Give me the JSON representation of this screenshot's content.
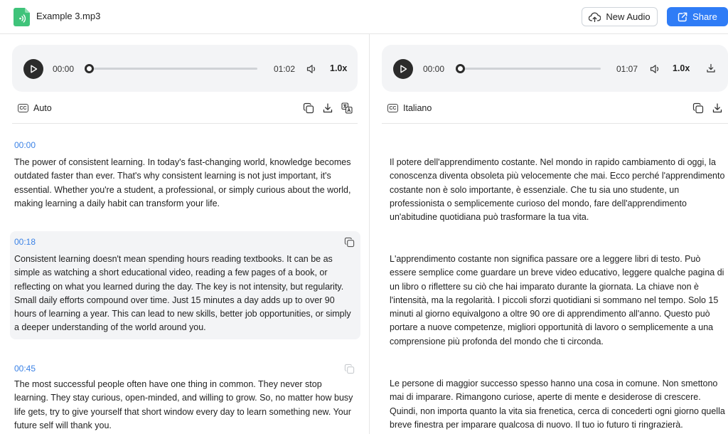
{
  "header": {
    "file_name": "Example 3.mp3",
    "new_audio_label": "New Audio",
    "share_label": "Share",
    "colors": {
      "accent": "#2f7cf6",
      "file_icon": "#3fc37a"
    }
  },
  "left": {
    "player": {
      "current_time": "00:00",
      "duration": "01:02",
      "speed": "1.0x",
      "progress": 0
    },
    "language": "Auto",
    "segments": [
      {
        "timestamp": "00:00",
        "text": "The power of consistent learning. In today's fast-changing world, knowledge becomes outdated faster than ever. That's why consistent learning is not just important, it's essential. Whether you're a student, a professional, or simply curious about the world, making learning a daily habit can transform your life."
      },
      {
        "timestamp": "00:18",
        "text": "Consistent learning doesn't mean spending hours reading textbooks. It can be as simple as watching a short educational video, reading a few pages of a book, or reflecting on what you learned during the day. The key is not intensity, but regularity. Small daily efforts compound over time. Just 15 minutes a day adds up to over 90 hours of learning a year. This can lead to new skills, better job opportunities, or simply a deeper understanding of the world around you."
      },
      {
        "timestamp": "00:45",
        "text": "The most successful people often have one thing in common. They never stop learning. They stay curious, open-minded, and willing to grow. So, no matter how busy life gets, try to give yourself that short window every day to learn something new. Your future self will thank you."
      }
    ]
  },
  "right": {
    "player": {
      "current_time": "00:00",
      "duration": "01:07",
      "speed": "1.0x",
      "progress": 0
    },
    "language": "Italiano",
    "segments": [
      {
        "text": "Il potere dell'apprendimento costante. Nel mondo in rapido cambiamento di oggi, la conoscenza diventa obsoleta più velocemente che mai. Ecco perché l'apprendimento costante non è solo importante, è essenziale. Che tu sia uno studente, un professionista o semplicemente curioso del mondo, fare dell'apprendimento un'abitudine quotidiana può trasformare la tua vita."
      },
      {
        "text": "L'apprendimento costante non significa passare ore a leggere libri di testo. Può essere semplice come guardare un breve video educativo, leggere qualche pagina di un libro o riflettere su ciò che hai imparato durante la giornata. La chiave non è l'intensità, ma la regolarità. I piccoli sforzi quotidiani si sommano nel tempo. Solo 15 minuti al giorno equivalgono a oltre 90 ore di apprendimento all'anno. Questo può portare a nuove competenze, migliori opportunità di lavoro o semplicemente a una comprensione più profonda del mondo che ti circonda."
      },
      {
        "text": "Le persone di maggior successo spesso hanno una cosa in comune. Non smettono mai di imparare. Rimangono curiose, aperte di mente e desiderose di crescere. Quindi, non importa quanto la vita sia frenetica, cerca di concederti ogni giorno quella breve finestra per imparare qualcosa di nuovo. Il tuo io futuro ti ringrazierà."
      }
    ]
  }
}
